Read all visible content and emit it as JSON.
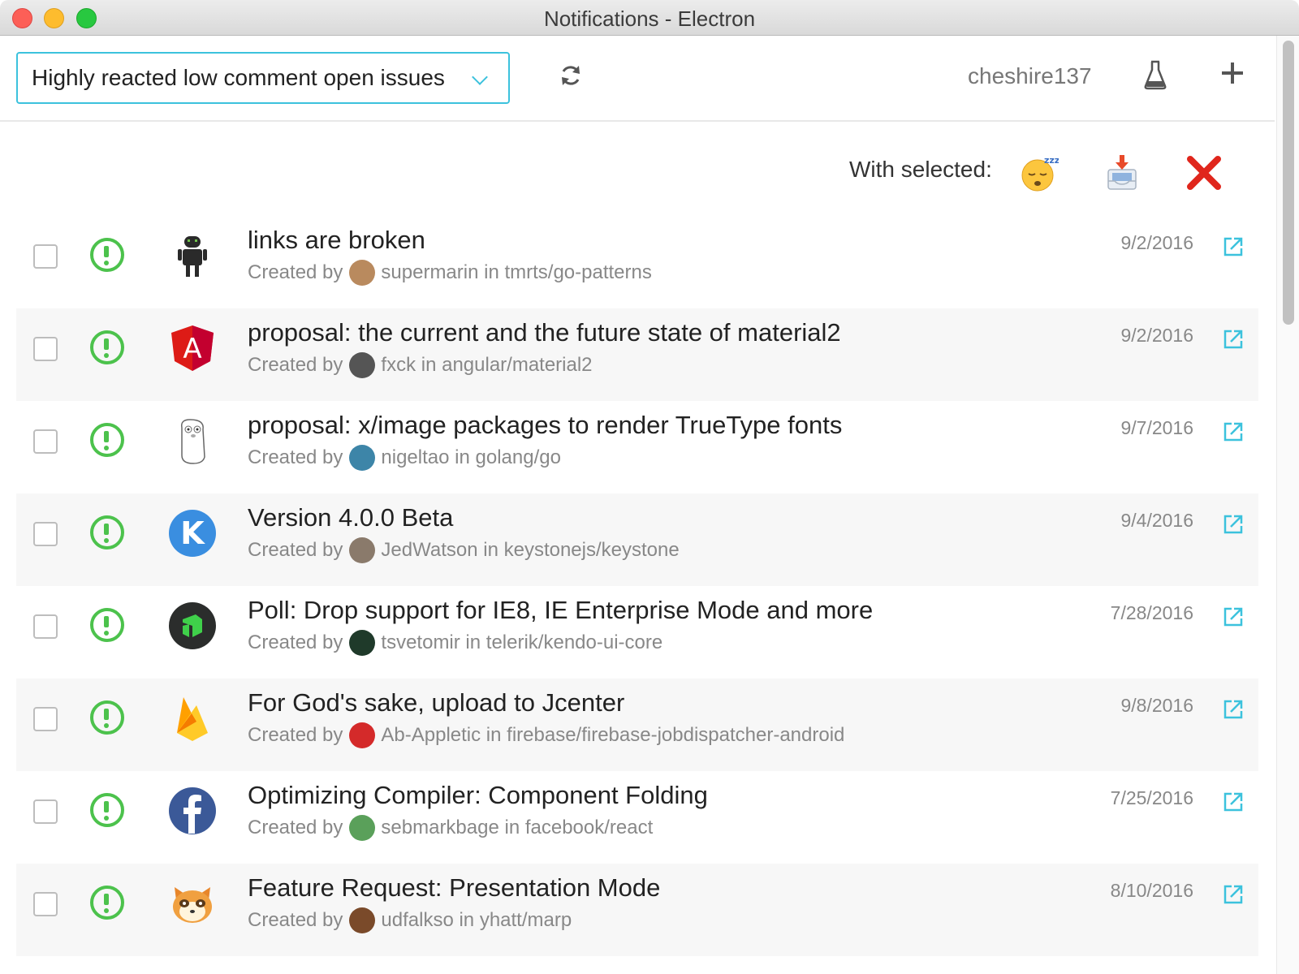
{
  "window": {
    "title": "Notifications - Electron"
  },
  "header": {
    "filter_label": "Highly reacted low comment open issues",
    "username": "cheshire137"
  },
  "bulk": {
    "label": "With selected:"
  },
  "colors": {
    "accent": "#3cc2dd",
    "open_issue": "#4cc24c",
    "delete": "#e0261c"
  },
  "issues": [
    {
      "title": "links are broken",
      "creator": "supermarin",
      "repo": "tmrts/go-patterns",
      "date": "9/2/2016",
      "repo_icon": "gopher-android-icon",
      "user_color": "#b98a5e"
    },
    {
      "title": "proposal: the current and the future state of material2",
      "creator": "fxck",
      "repo": "angular/material2",
      "date": "9/2/2016",
      "repo_icon": "angular-logo-icon",
      "user_color": "#555"
    },
    {
      "title": "proposal: x/image packages to render TrueType fonts",
      "creator": "nigeltao",
      "repo": "golang/go",
      "date": "9/7/2016",
      "repo_icon": "go-gopher-icon",
      "user_color": "#3d85a8"
    },
    {
      "title": "Version 4.0.0 Beta",
      "creator": "JedWatson",
      "repo": "keystonejs/keystone",
      "date": "9/4/2016",
      "repo_icon": "keystone-logo-icon",
      "user_color": "#8a7a6b"
    },
    {
      "title": "Poll: Drop support for IE8, IE Enterprise Mode and more",
      "creator": "tsvetomir",
      "repo": "telerik/kendo-ui-core",
      "date": "7/28/2016",
      "repo_icon": "kendo-ui-logo-icon",
      "user_color": "#1f3a2a"
    },
    {
      "title": "For God's sake, upload to Jcenter",
      "creator": "Ab-Appletic",
      "repo": "firebase/firebase-jobdispatcher-android",
      "date": "9/8/2016",
      "repo_icon": "firebase-logo-icon",
      "user_color": "#d42a2a"
    },
    {
      "title": "Optimizing Compiler: Component Folding",
      "creator": "sebmarkbage",
      "repo": "facebook/react",
      "date": "7/25/2016",
      "repo_icon": "facebook-logo-icon",
      "user_color": "#5aa05a"
    },
    {
      "title": "Feature Request: Presentation Mode",
      "creator": "udfalkso",
      "repo": "yhatt/marp",
      "date": "8/10/2016",
      "repo_icon": "raccoon-mascot-icon",
      "user_color": "#7a4a2a"
    }
  ]
}
